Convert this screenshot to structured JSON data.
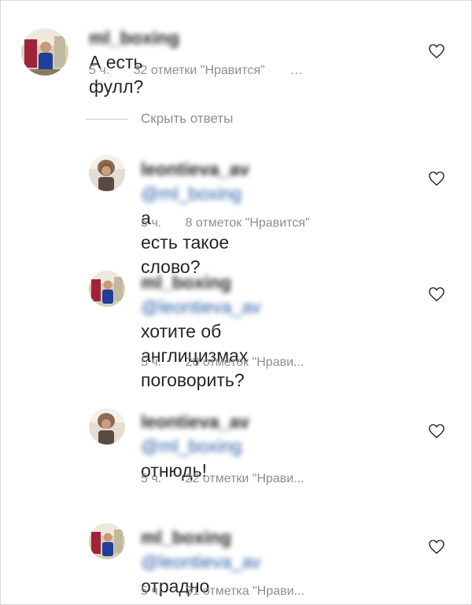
{
  "comments": [
    {
      "username": "ml_boxing",
      "mention": "",
      "text": "А есть фулл?",
      "text_line2": "",
      "time": "5 ч.",
      "likes": "32 отметки \"Нравится\"",
      "more": "..."
    },
    {
      "username": "leontieva_av",
      "mention": "@ml_boxing",
      "text": "а",
      "text_line2": "есть такое слово?",
      "time": "5 ч.",
      "likes": "8 отметок \"Нравится\"",
      "more": ""
    },
    {
      "username": "ml_boxing",
      "mention": "@leontieva_av",
      "text": "",
      "text_line2": "хотите об англицизмах",
      "text_line3": "поговорить?",
      "time": "5 ч.",
      "likes": "20 отметок \"Нрави...",
      "more": ""
    },
    {
      "username": "leontieva_av",
      "mention": "@ml_boxing",
      "text": "",
      "text_line2": "отнюдь!",
      "time": "5 ч.",
      "likes": "22 отметки \"Нрави...",
      "more": ""
    },
    {
      "username": "ml_boxing",
      "mention": "@leontieva_av",
      "text": "",
      "text_line2": "отрадно",
      "time": "5 ч.",
      "likes": "31 отметка \"Нрави...",
      "more": ""
    }
  ],
  "hide_replies_label": "Скрыть ответы",
  "icons": {
    "like": "heart-outline-icon"
  },
  "colors": {
    "text": "#262626",
    "meta": "#8e8e8e",
    "mention": "#2a5fa8"
  }
}
